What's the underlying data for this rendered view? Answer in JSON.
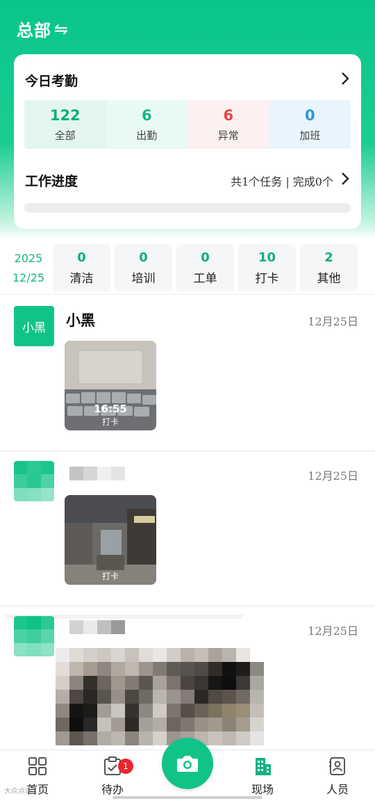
{
  "header": {
    "title": "总部",
    "switch_icon": "swap-arrows-icon"
  },
  "attendance_card": {
    "title": "今日考勤",
    "stats": [
      {
        "value": "122",
        "label": "全部",
        "color": "#0fae7e",
        "bg": "#e3f6ee"
      },
      {
        "value": "6",
        "label": "出勤",
        "color": "#13b886",
        "bg": "#e9faf5"
      },
      {
        "value": "6",
        "label": "异常",
        "color": "#e0454c",
        "bg": "#fdf0f0"
      },
      {
        "value": "0",
        "label": "加班",
        "color": "#2b9ad8",
        "bg": "#e9f5fd"
      }
    ],
    "progress": {
      "title": "工作进度",
      "summary": "共1个任务 | 完成0个",
      "completed_fraction": 0
    }
  },
  "category_bar": {
    "date_year": "2025",
    "date_md": "12/25",
    "items": [
      {
        "value": "0",
        "label": "清洁"
      },
      {
        "value": "0",
        "label": "培训"
      },
      {
        "value": "0",
        "label": "工单"
      },
      {
        "value": "10",
        "label": "打卡"
      },
      {
        "value": "2",
        "label": "其他"
      }
    ]
  },
  "feed": [
    {
      "avatar_text": "小黑",
      "name": "小黑",
      "date": "12月25日",
      "photo_time": "16:55",
      "photo_label": "打卡"
    },
    {
      "name": "",
      "date": "12月25日",
      "photo_label": "打卡"
    },
    {
      "name": "",
      "date": "12月25日"
    }
  ],
  "tabbar": {
    "tabs": [
      {
        "label": "首页",
        "icon": "grid-icon"
      },
      {
        "label": "待办",
        "icon": "clipboard-check-icon",
        "badge": "1"
      },
      {
        "label": "现场",
        "icon": "building-icon",
        "active": true
      },
      {
        "label": "人员",
        "icon": "contacts-icon"
      }
    ],
    "camera_icon": "camera-icon",
    "active_color": "#12b383"
  },
  "watermark": "大众点评"
}
